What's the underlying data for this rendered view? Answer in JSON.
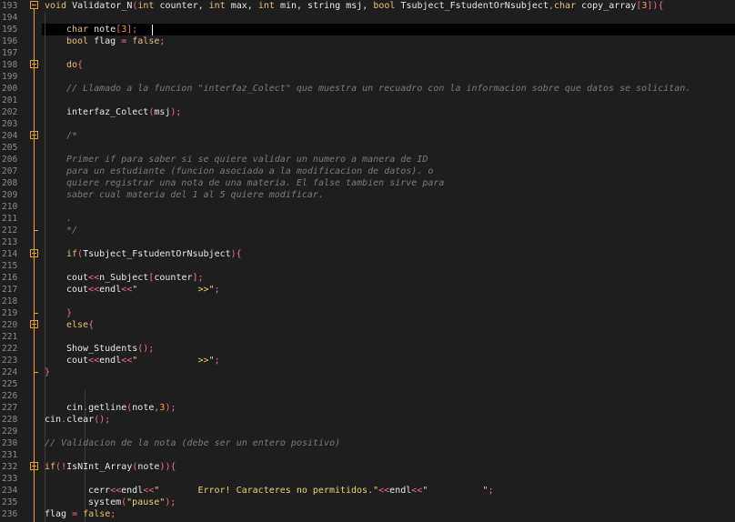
{
  "editor": {
    "lines": [
      {
        "n": "193",
        "tokens": [
          [
            "kw",
            "void "
          ],
          [
            "tx",
            "Validator_N"
          ],
          [
            "pk",
            "("
          ],
          [
            "kw",
            "int "
          ],
          [
            "tx",
            "counter, "
          ],
          [
            "kw",
            "int "
          ],
          [
            "tx",
            "max, "
          ],
          [
            "kw",
            "int "
          ],
          [
            "tx",
            "min, string msj, "
          ],
          [
            "kw",
            "bool "
          ],
          [
            "tx",
            "Tsubject_FstudentOrNsubject"
          ],
          [
            "pk",
            ","
          ],
          [
            "kw",
            "char "
          ],
          [
            "tx",
            "copy_array"
          ],
          [
            "pk",
            "["
          ],
          [
            "num",
            "3"
          ],
          [
            "pk",
            "]){"
          ]
        ]
      },
      {
        "n": "194",
        "tokens": []
      },
      {
        "n": "195",
        "tokens": [
          [
            "kw",
            "char "
          ],
          [
            "tx",
            "note"
          ],
          [
            "pk",
            "["
          ],
          [
            "num",
            "3"
          ],
          [
            "pk",
            "];"
          ]
        ]
      },
      {
        "n": "196",
        "tokens": [
          [
            "kw",
            "bool "
          ],
          [
            "tx",
            "flag "
          ],
          [
            "pk",
            "= "
          ],
          [
            "kw",
            "false"
          ],
          [
            "pk",
            ";"
          ]
        ]
      },
      {
        "n": "197",
        "tokens": []
      },
      {
        "n": "198",
        "tokens": [
          [
            "kw",
            "do"
          ],
          [
            "pk",
            "{"
          ]
        ]
      },
      {
        "n": "199",
        "tokens": []
      },
      {
        "n": "200",
        "tokens": [
          [
            "cm",
            "// Llamado a la funcion \"interfaz_Colect\" que muestra un recuadro con la informacion sobre que datos se solicitan."
          ]
        ]
      },
      {
        "n": "201",
        "tokens": []
      },
      {
        "n": "202",
        "tokens": [
          [
            "tx",
            "interfaz_Colect"
          ],
          [
            "pk",
            "("
          ],
          [
            "tx",
            "msj"
          ],
          [
            "pk",
            ");"
          ]
        ]
      },
      {
        "n": "203",
        "tokens": []
      },
      {
        "n": "204",
        "tokens": [
          [
            "cm",
            "/*"
          ]
        ]
      },
      {
        "n": "205",
        "tokens": []
      },
      {
        "n": "206",
        "tokens": [
          [
            "cm",
            "Primer if para saber si se quiere validar un numero a manera de ID"
          ]
        ]
      },
      {
        "n": "207",
        "tokens": [
          [
            "cm",
            "para un estudiante (funcion asociada a la modificacion de datos). o"
          ]
        ]
      },
      {
        "n": "208",
        "tokens": [
          [
            "cm",
            "quiere registrar una nota de una materia. El false tambien sirve para"
          ]
        ]
      },
      {
        "n": "209",
        "tokens": [
          [
            "cm",
            "saber cual materia del 1 al 5 quiere modificar."
          ]
        ]
      },
      {
        "n": "210",
        "tokens": []
      },
      {
        "n": "211",
        "tokens": [
          [
            "cm",
            "."
          ]
        ]
      },
      {
        "n": "212",
        "tokens": [
          [
            "cm",
            "*/"
          ]
        ]
      },
      {
        "n": "213",
        "tokens": []
      },
      {
        "n": "214",
        "tokens": [
          [
            "kw",
            "if"
          ],
          [
            "pk",
            "("
          ],
          [
            "tx",
            "Tsubject_FstudentOrNsubject"
          ],
          [
            "pk",
            "){"
          ]
        ]
      },
      {
        "n": "215",
        "tokens": []
      },
      {
        "n": "216",
        "tokens": [
          [
            "tx",
            "cout"
          ],
          [
            "pk",
            "<<"
          ],
          [
            "tx",
            "n_Subject"
          ],
          [
            "pk",
            "["
          ],
          [
            "tx",
            "counter"
          ],
          [
            "pk",
            "];"
          ]
        ]
      },
      {
        "n": "217",
        "tokens": [
          [
            "tx",
            "cout"
          ],
          [
            "pk",
            "<<"
          ],
          [
            "tx",
            "endl"
          ],
          [
            "pk",
            "<<"
          ],
          [
            "str",
            "\"           >>\""
          ],
          [
            "pk",
            ";"
          ]
        ]
      },
      {
        "n": "218",
        "tokens": []
      },
      {
        "n": "219",
        "tokens": [
          [
            "pk",
            "}"
          ]
        ]
      },
      {
        "n": "220",
        "tokens": [
          [
            "kw",
            "else"
          ],
          [
            "pk",
            "{"
          ]
        ]
      },
      {
        "n": "221",
        "tokens": []
      },
      {
        "n": "222",
        "tokens": [
          [
            "tx",
            "Show_Students"
          ],
          [
            "pk",
            "();"
          ]
        ]
      },
      {
        "n": "223",
        "tokens": [
          [
            "tx",
            "cout"
          ],
          [
            "pk",
            "<<"
          ],
          [
            "tx",
            "endl"
          ],
          [
            "pk",
            "<<"
          ],
          [
            "str",
            "\"           >>\""
          ],
          [
            "pk",
            ";"
          ]
        ]
      },
      {
        "n": "224",
        "tokens": [
          [
            "pk",
            "}"
          ]
        ]
      },
      {
        "n": "225",
        "tokens": []
      },
      {
        "n": "226",
        "tokens": []
      },
      {
        "n": "227",
        "tokens": [
          [
            "tx",
            "cin"
          ],
          [
            "pk",
            "."
          ],
          [
            "tx",
            "getline"
          ],
          [
            "pk",
            "("
          ],
          [
            "tx",
            "note"
          ],
          [
            "pk",
            ","
          ],
          [
            "num",
            "3"
          ],
          [
            "pk",
            ");"
          ]
        ]
      },
      {
        "n": "228",
        "tokens": [
          [
            "tx",
            "cin"
          ],
          [
            "pk",
            "."
          ],
          [
            "tx",
            "clear"
          ],
          [
            "pk",
            "();"
          ]
        ]
      },
      {
        "n": "229",
        "tokens": []
      },
      {
        "n": "230",
        "tokens": [
          [
            "cm",
            "// Validacion de la nota (debe ser un entero positivo)"
          ]
        ]
      },
      {
        "n": "231",
        "tokens": []
      },
      {
        "n": "232",
        "tokens": [
          [
            "kw",
            "if"
          ],
          [
            "pk",
            "(!"
          ],
          [
            "tx",
            "IsNInt_Array"
          ],
          [
            "pk",
            "("
          ],
          [
            "tx",
            "note"
          ],
          [
            "pk",
            ")){"
          ]
        ]
      },
      {
        "n": "233",
        "tokens": []
      },
      {
        "n": "234",
        "tokens": [
          [
            "tx",
            "cerr"
          ],
          [
            "pk",
            "<<"
          ],
          [
            "tx",
            "endl"
          ],
          [
            "pk",
            "<<"
          ],
          [
            "str",
            "\"       Error! Caracteres no permitidos.\""
          ],
          [
            "pk",
            "<<"
          ],
          [
            "tx",
            "endl"
          ],
          [
            "pk",
            "<<"
          ],
          [
            "str",
            "\"          \""
          ],
          [
            "pk",
            ";"
          ]
        ]
      },
      {
        "n": "235",
        "tokens": [
          [
            "tx",
            "system"
          ],
          [
            "pk",
            "("
          ],
          [
            "str",
            "\"pause\""
          ],
          [
            "pk",
            ");"
          ]
        ]
      },
      {
        "n": "236",
        "tokens": [
          [
            "tx",
            "flag "
          ],
          [
            "pk",
            "= "
          ],
          [
            "kw",
            "false"
          ],
          [
            "pk",
            ";"
          ]
        ]
      }
    ]
  }
}
